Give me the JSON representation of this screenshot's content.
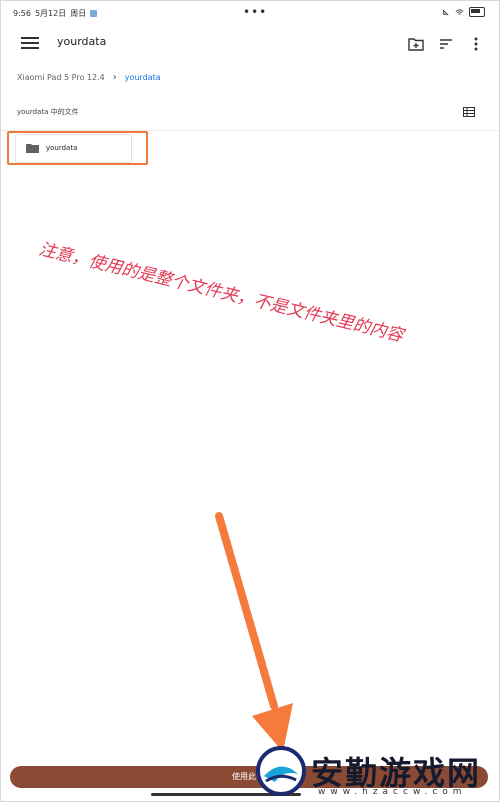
{
  "status_bar": {
    "time": "9:56",
    "date": "5月12日",
    "weekday": "周日",
    "dots": "•••"
  },
  "toolbar": {
    "title": "yourdata"
  },
  "breadcrumb": {
    "device": "Xiaomi Pad 5 Pro 12.4",
    "current": "yourdata"
  },
  "section": {
    "title": "yourdata 中的文件"
  },
  "folder": {
    "name": "yourdata"
  },
  "annotation": {
    "line1": "注意，使用的是整个文件夹，不是文件夹里的内容"
  },
  "bottom": {
    "use_button_label": "使用此"
  },
  "watermark": {
    "name": "安勤游戏网",
    "url": "www.hzaccw.com"
  },
  "colors": {
    "highlight": "#f07a3b",
    "annotation": "#e23a55",
    "button": "#8b4a33",
    "accent": "#1a73e8"
  }
}
